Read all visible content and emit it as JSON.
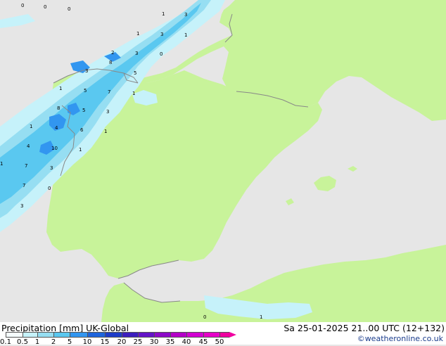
{
  "map": {
    "region": "Iberian Peninsula",
    "colors": {
      "sea": "#e6e6e6",
      "land": "#c8f39a",
      "coast": "#888888",
      "rain_light": "#c6f2fa",
      "rain_mid": "#96def2",
      "rain_heavy": "#5ac8f0",
      "rain_core": "#3296f0"
    },
    "precip_values": [
      "0",
      "0",
      "0",
      "1",
      "3",
      "1",
      "3",
      "1",
      "2",
      "3",
      "0",
      "3",
      "8",
      "5",
      "1",
      "5",
      "7",
      "1",
      "8",
      "5",
      "3",
      "1",
      "4",
      "6",
      "1",
      "4",
      "10",
      "1",
      "1",
      "7",
      "3",
      "7",
      "0",
      "3",
      "0",
      "1"
    ]
  },
  "footer": {
    "title": "Precipitation [mm]  UK-Global",
    "datetime": "Sa 25-01-2025 21..00 UTC (12+132)",
    "credit": "©weatheronline.co.uk"
  },
  "scale": {
    "ticks": [
      "0.1",
      "0.5",
      "1",
      "2",
      "5",
      "10",
      "15",
      "20",
      "25",
      "30",
      "35",
      "40",
      "45",
      "50"
    ],
    "colors": [
      "#f5fcfe",
      "#c6f2fa",
      "#96def2",
      "#5ac8f0",
      "#3296f0",
      "#1e64dc",
      "#1e3cc8",
      "#3c1ebe",
      "#6414c8",
      "#8c0ac8",
      "#b400c8",
      "#d200d2",
      "#e600c8",
      "#f000a0"
    ]
  }
}
